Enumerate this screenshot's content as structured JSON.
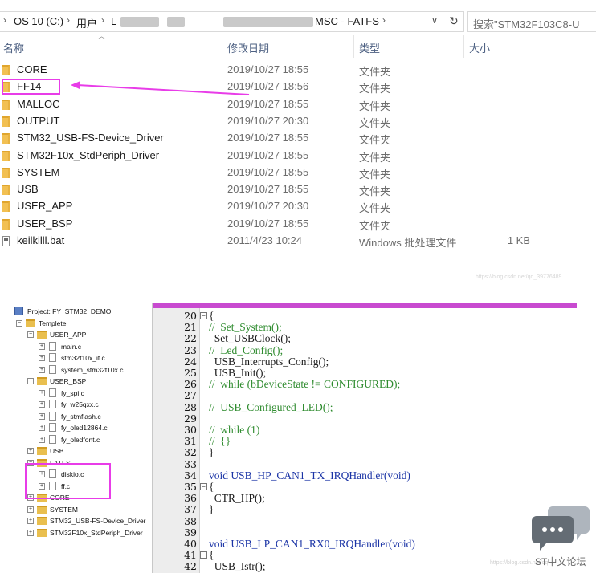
{
  "explorer": {
    "breadcrumb": {
      "drive": "OS 10 (C:)",
      "users": "用户",
      "partial_user": "L",
      "folder": "MSC - FATFS"
    },
    "search_placeholder": "搜索\"STM32F103C8-U",
    "columns": {
      "name": "名称",
      "date": "修改日期",
      "type": "类型",
      "size": "大小"
    },
    "rows": [
      {
        "name": "CORE",
        "date": "2019/10/27 18:55",
        "type": "文件夹",
        "size": "",
        "kind": "folder"
      },
      {
        "name": "FF14",
        "date": "2019/10/27 18:56",
        "type": "文件夹",
        "size": "",
        "kind": "folder"
      },
      {
        "name": "MALLOC",
        "date": "2019/10/27 18:55",
        "type": "文件夹",
        "size": "",
        "kind": "folder"
      },
      {
        "name": "OUTPUT",
        "date": "2019/10/27 20:30",
        "type": "文件夹",
        "size": "",
        "kind": "folder"
      },
      {
        "name": "STM32_USB-FS-Device_Driver",
        "date": "2019/10/27 18:55",
        "type": "文件夹",
        "size": "",
        "kind": "folder"
      },
      {
        "name": "STM32F10x_StdPeriph_Driver",
        "date": "2019/10/27 18:55",
        "type": "文件夹",
        "size": "",
        "kind": "folder"
      },
      {
        "name": "SYSTEM",
        "date": "2019/10/27 18:55",
        "type": "文件夹",
        "size": "",
        "kind": "folder"
      },
      {
        "name": "USB",
        "date": "2019/10/27 18:55",
        "type": "文件夹",
        "size": "",
        "kind": "folder"
      },
      {
        "name": "USER_APP",
        "date": "2019/10/27 20:30",
        "type": "文件夹",
        "size": "",
        "kind": "folder"
      },
      {
        "name": "USER_BSP",
        "date": "2019/10/27 18:55",
        "type": "文件夹",
        "size": "",
        "kind": "folder"
      },
      {
        "name": "keilkilll.bat",
        "date": "2011/4/23 10:24",
        "type": "Windows 批处理文件",
        "size": "1 KB",
        "kind": "file"
      }
    ]
  },
  "project_tree": {
    "nodes": [
      {
        "label": "Project: FY_STM32_DEMO",
        "icon": "project"
      },
      {
        "label": "Templete",
        "icon": "folder"
      },
      {
        "label": "USER_APP",
        "icon": "folder"
      },
      {
        "label": "main.c",
        "icon": "file"
      },
      {
        "label": "stm32f10x_it.c",
        "icon": "file"
      },
      {
        "label": "system_stm32f10x.c",
        "icon": "file"
      },
      {
        "label": "USER_BSP",
        "icon": "folder"
      },
      {
        "label": "fy_spi.c",
        "icon": "file"
      },
      {
        "label": "fy_w25qxx.c",
        "icon": "file"
      },
      {
        "label": "fy_stmflash.c",
        "icon": "file"
      },
      {
        "label": "fy_oled12864.c",
        "icon": "file"
      },
      {
        "label": "fy_oledfont.c",
        "icon": "file"
      },
      {
        "label": "USB",
        "icon": "folder"
      },
      {
        "label": "FATFS",
        "icon": "folder"
      },
      {
        "label": "diskio.c",
        "icon": "file"
      },
      {
        "label": "ff.c",
        "icon": "file"
      },
      {
        "label": "CORE",
        "icon": "folder"
      },
      {
        "label": "SYSTEM",
        "icon": "folder"
      },
      {
        "label": "STM32_USB-FS-Device_Driver",
        "icon": "folder"
      },
      {
        "label": "STM32F10x_StdPeriph_Driver",
        "icon": "folder"
      }
    ]
  },
  "code": {
    "lines": [
      {
        "n": "20",
        "fold": "⊟",
        "t": "{"
      },
      {
        "n": "21",
        "fold": "",
        "t": "//  Set_System();"
      },
      {
        "n": "22",
        "fold": "",
        "t": "  Set_USBClock();"
      },
      {
        "n": "23",
        "fold": "",
        "t": "//  Led_Config();"
      },
      {
        "n": "24",
        "fold": "",
        "t": "  USB_Interrupts_Config();"
      },
      {
        "n": "25",
        "fold": "",
        "t": "  USB_Init();"
      },
      {
        "n": "26",
        "fold": "",
        "t": "//  while (bDeviceState != CONFIGURED);"
      },
      {
        "n": "27",
        "fold": "",
        "t": ""
      },
      {
        "n": "28",
        "fold": "",
        "t": "//  USB_Configured_LED();"
      },
      {
        "n": "29",
        "fold": "",
        "t": ""
      },
      {
        "n": "30",
        "fold": "",
        "t": "//  while (1)"
      },
      {
        "n": "31",
        "fold": "",
        "t": "//  {}"
      },
      {
        "n": "32",
        "fold": "",
        "t": "}"
      },
      {
        "n": "33",
        "fold": "",
        "t": ""
      },
      {
        "n": "34",
        "fold": "",
        "t": "void USB_HP_CAN1_TX_IRQHandler(void)"
      },
      {
        "n": "35",
        "fold": "⊟",
        "t": "{"
      },
      {
        "n": "36",
        "fold": "",
        "t": "  CTR_HP();"
      },
      {
        "n": "37",
        "fold": "",
        "t": "}"
      },
      {
        "n": "38",
        "fold": "",
        "t": ""
      },
      {
        "n": "39",
        "fold": "",
        "t": ""
      },
      {
        "n": "40",
        "fold": "",
        "t": "void USB_LP_CAN1_RX0_IRQHandler(void)"
      },
      {
        "n": "41",
        "fold": "⊟",
        "t": "{"
      },
      {
        "n": "42",
        "fold": "",
        "t": "  USB_Istr();"
      }
    ]
  },
  "footer": {
    "forum": "ST中文论坛"
  },
  "watermarks": {
    "top": "https://blog.csdn.net/qq_39776489",
    "bottom": "https://blog.csdn.net/qq"
  },
  "colors": {
    "highlight": "#e83ce8",
    "comment": "#2e8b2e",
    "keyword": "#1b34a6"
  },
  "icons": [
    "folder-icon",
    "bat-file-icon",
    "refresh-icon",
    "chevron-down-icon",
    "chevron-right-icon",
    "chat-bubble-icon"
  ]
}
